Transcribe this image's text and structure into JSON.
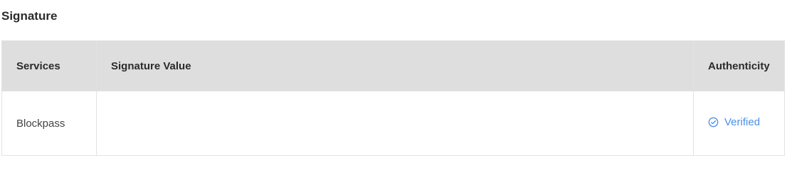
{
  "section": {
    "title": "Signature"
  },
  "table": {
    "headers": {
      "services": "Services",
      "signature_value": "Signature Value",
      "authenticity": "Authenticity"
    },
    "rows": [
      {
        "service": "Blockpass",
        "signature_value": "",
        "authenticity": {
          "label": "Verified",
          "icon": "check-circle-icon",
          "color": "#4a8fe7"
        }
      }
    ]
  },
  "colors": {
    "header_bg": "#dedede",
    "border": "#e2e2e2",
    "accent": "#4a8fe7"
  }
}
